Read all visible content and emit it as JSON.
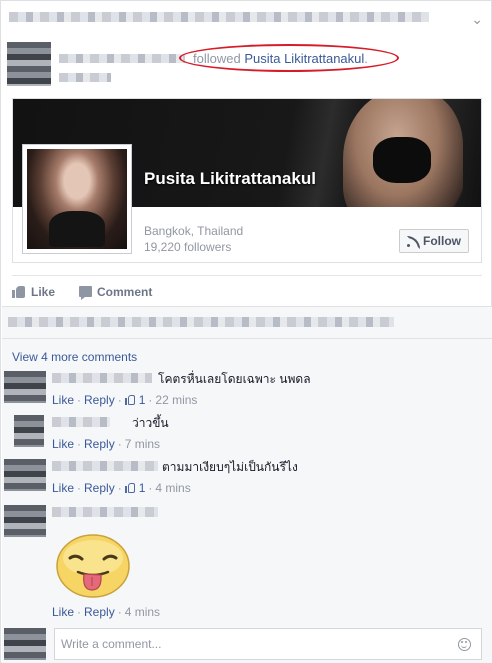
{
  "header": {
    "verb": "followed",
    "target_name": "Pusita Likitrattanakul",
    "trailing": "."
  },
  "card": {
    "page_name": "Pusita Likitrattanakul",
    "location": "Bangkok, Thailand",
    "followers": "19,220 followers",
    "follow_label": "Follow"
  },
  "actions": {
    "like_label": "Like",
    "comment_label": "Comment"
  },
  "comments": {
    "view_more": "View 4 more comments",
    "items": [
      {
        "text": "โคตรหื่นเลยโดยเฉพาะ นพดล",
        "like_label": "Like",
        "reply_label": "Reply",
        "like_count": "1",
        "time": "22 mins"
      },
      {
        "text": "ว่าวขึ้น",
        "like_label": "Like",
        "reply_label": "Reply",
        "time": "7 mins"
      },
      {
        "text": "ตามมาเงียบๆไม่เป็นกันรึไง",
        "like_label": "Like",
        "reply_label": "Reply",
        "like_count": "1",
        "time": "4 mins"
      },
      {
        "text": "",
        "like_label": "Like",
        "reply_label": "Reply",
        "time": "4 mins"
      }
    ],
    "separator": "·",
    "compose_placeholder": "Write a comment..."
  },
  "colors": {
    "link": "#3b5998",
    "meta": "#9197a3",
    "highlight_ring": "#d61c28",
    "comments_bg": "#f6f7f9"
  },
  "icons": [
    "like-thumb-icon",
    "comment-bubble-icon",
    "follow-rss-icon",
    "emoji-icon",
    "sticker-tongue-icon",
    "dropdown-caret-icon"
  ]
}
